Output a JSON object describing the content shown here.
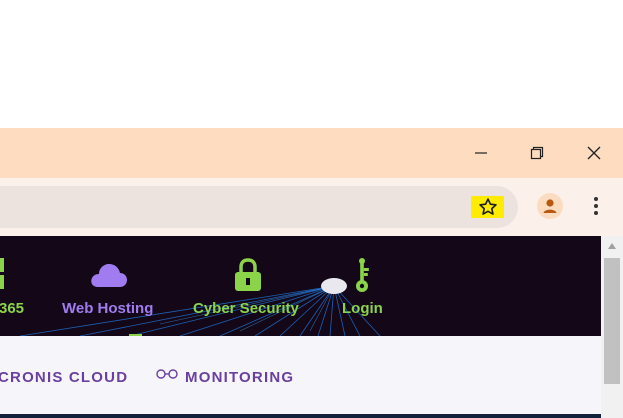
{
  "browser": {
    "icons": {
      "minimize": "minimize-icon",
      "restore": "restore-icon",
      "close": "close-icon",
      "bookmark": "star-icon",
      "profile": "person-icon",
      "menu": "kebab-menu-icon"
    },
    "highlight_color": "#ffec00",
    "titlebar_color": "#fddcc0"
  },
  "site_nav": {
    "background": "#140818",
    "items": [
      {
        "label": "365",
        "icon": "windows-grid-icon",
        "color": "#8bd44a"
      },
      {
        "label": "Web Hosting",
        "icon": "cloud-icon",
        "color": "#a07cf0"
      },
      {
        "label": "Cyber Security",
        "icon": "lock-icon",
        "color": "#8bd44a"
      },
      {
        "label": "Login",
        "icon": "key-icon",
        "color": "#8bd44a"
      }
    ]
  },
  "sub_nav": {
    "items": [
      {
        "label": "CRONIS CLOUD"
      },
      {
        "label": "MONITORING",
        "icon": "glasses-icon"
      }
    ],
    "text_color": "#6a3fa0"
  }
}
